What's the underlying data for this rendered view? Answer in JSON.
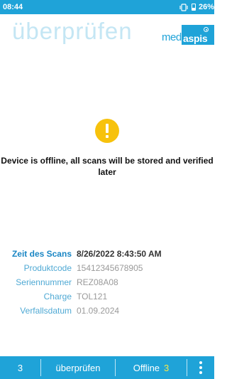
{
  "status_bar": {
    "time": "08:44",
    "battery": "26%",
    "icons": [
      "vibrate-icon",
      "battery-icon"
    ]
  },
  "header": {
    "title": "überprüfen",
    "logo_med": "med",
    "logo_aspis": "aspis"
  },
  "message": {
    "icon": "warning-icon",
    "text": "Device is offline, all scans will be stored and verified later"
  },
  "details": {
    "rows": [
      {
        "label": "Zeit des Scans",
        "value": "8/26/2022 8:43:50 AM"
      },
      {
        "label": "Produktcode",
        "value": "15412345678905"
      },
      {
        "label": "Seriennummer",
        "value": "REZ08A08"
      },
      {
        "label": "Charge",
        "value": "TOL121"
      },
      {
        "label": "Verfallsdatum",
        "value": "01.09.2024"
      }
    ]
  },
  "bottom_bar": {
    "count": "3",
    "verify_label": "überprüfen",
    "offline_label": "Offline",
    "offline_count": "3",
    "menu_icon": "more-vertical-icon"
  },
  "colors": {
    "primary": "#1fa3d8",
    "title_light": "#c4e6f4",
    "warning": "#f7c20c",
    "offline_count": "#f7e84a"
  }
}
